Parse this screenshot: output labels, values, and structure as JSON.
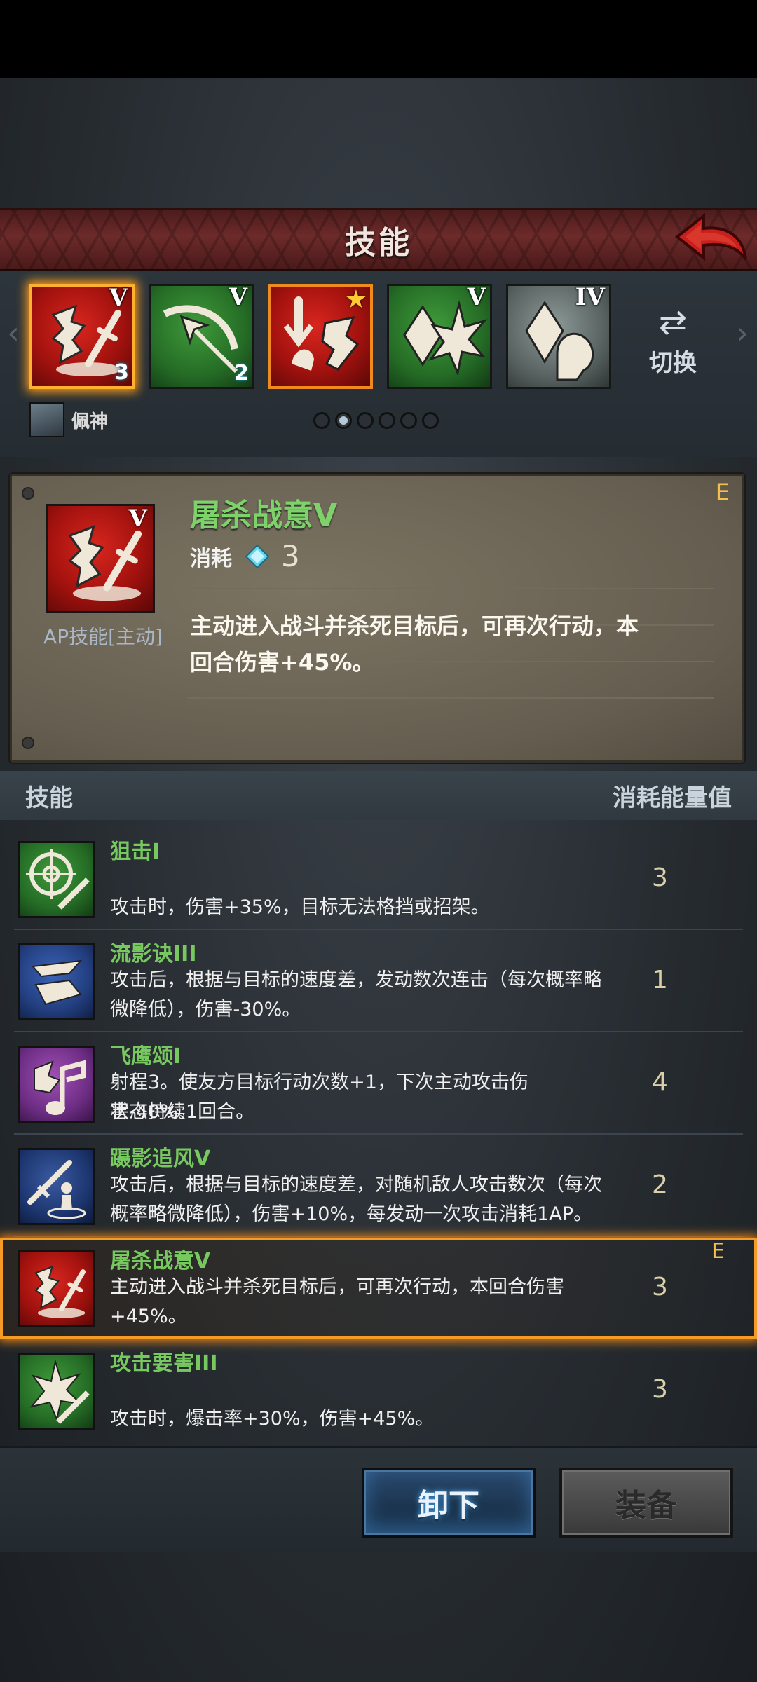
{
  "title": "技能",
  "icons": {
    "back": "back-arrow-icon",
    "switch": "swap-arrows-icon",
    "cost_gem": "energy-gem-icon"
  },
  "colors": {
    "title_bar": "#6d2a2a",
    "skill_name_green": "#7dd36a",
    "selection_orange": "#f59a25",
    "grade_yellow": "#f3c04a",
    "unequip_blue": "#1c3550"
  },
  "equipped_slots": [
    {
      "level": "V",
      "gem": "3",
      "bg": "red",
      "selected": true
    },
    {
      "level": "V",
      "gem": "2",
      "bg": "green",
      "selected": false
    },
    {
      "level": "",
      "gem": "",
      "bg": "red",
      "star": true,
      "selected": false
    },
    {
      "level": "V",
      "gem": "",
      "bg": "green",
      "selected": false
    },
    {
      "level": "IV",
      "gem": "",
      "bg": "gray",
      "selected": false
    }
  ],
  "switch_label": "切换",
  "hero": {
    "name": "佩神"
  },
  "pagination": {
    "total": 6,
    "current": 2
  },
  "detail": {
    "level": "V",
    "name": "屠杀战意V",
    "grade": "E",
    "cost_label": "消耗",
    "cost_value": "3",
    "type": "AP技能[主动]",
    "description_line1": "主动进入战斗并杀死目标后，可再次行动，本",
    "description_line2": "回合伤害+45%。"
  },
  "list_header": {
    "left": "技能",
    "right": "消耗能量值"
  },
  "skills": [
    {
      "name": "狙击I",
      "desc1": "",
      "desc2": "攻击时，伤害+35%，目标无法格挡或招架。",
      "cost": "3",
      "grade": "",
      "bg": "green"
    },
    {
      "name": "流影诀III",
      "desc1": "攻击后，根据与目标的速度差，发动数次连击（每次概率略",
      "desc2": "微降低），伤害-30%。",
      "cost": "1",
      "grade": "",
      "bg": "blue"
    },
    {
      "name": "飞鹰颂I",
      "desc1": "射程3。使友方目标行动次数+1，下次主动攻击伤害-40%。",
      "desc2": "状态持续1回合。",
      "cost": "4",
      "grade": "",
      "bg": "purple"
    },
    {
      "name": "蹑影追风V",
      "desc1": "攻击后，根据与目标的速度差，对随机敌人攻击数次（每次",
      "desc2": "概率略微降低），伤害+10%，每发动一次攻击消耗1AP。",
      "cost": "2",
      "grade": "",
      "bg": "navy"
    },
    {
      "name": "屠杀战意V",
      "desc1": "主动进入战斗并杀死目标后，可再次行动，本回合伤害",
      "desc2": "+45%。",
      "cost": "3",
      "grade": "E",
      "bg": "red",
      "selected": true
    },
    {
      "name": "攻击要害III",
      "desc1": "",
      "desc2": "攻击时，爆击率+30%，伤害+45%。",
      "cost": "3",
      "grade": "",
      "bg": "green"
    }
  ],
  "buttons": {
    "unequip": "卸下",
    "equip": "装备"
  }
}
